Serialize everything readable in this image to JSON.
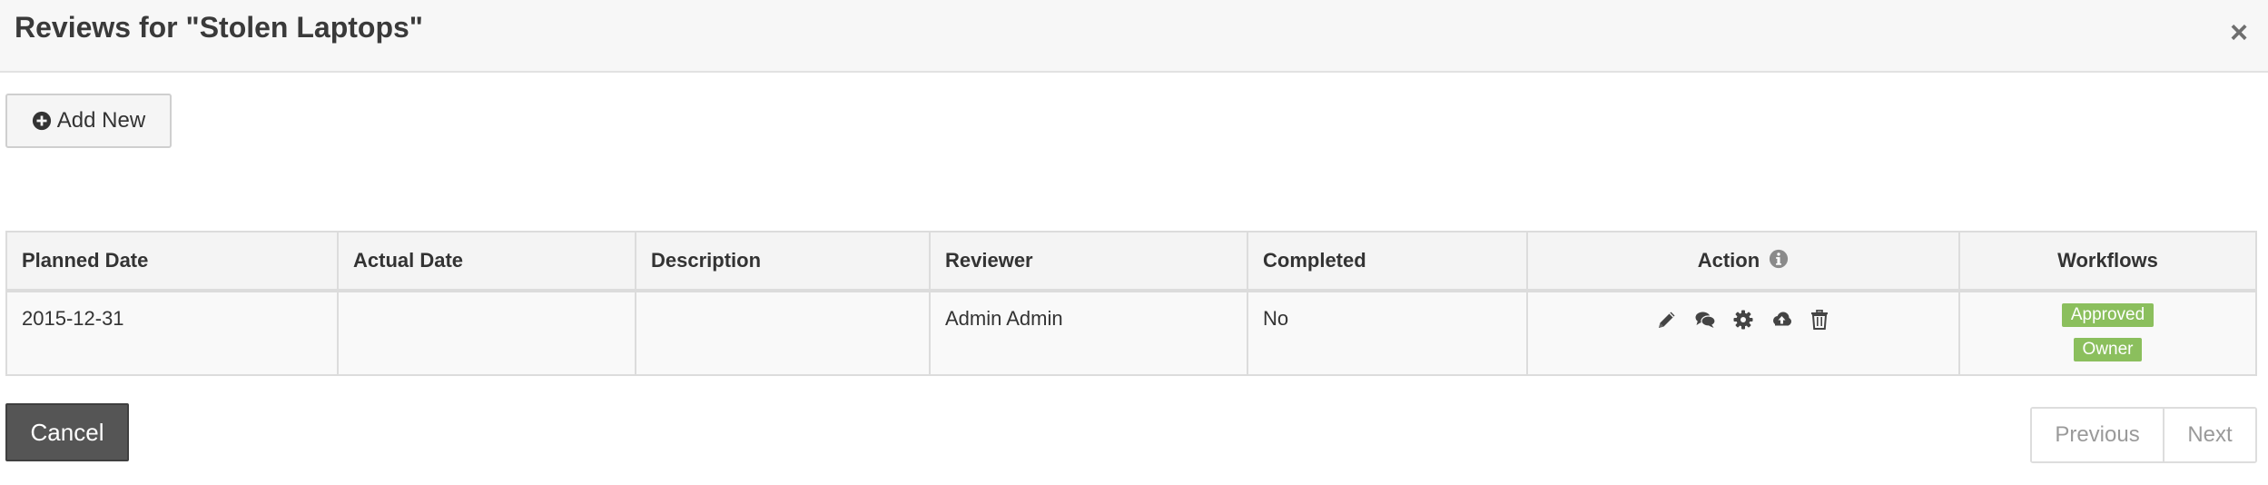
{
  "modal": {
    "title": "Reviews for \"Stolen Laptops\"",
    "close_label": "×"
  },
  "toolbar": {
    "add_new_label": "Add New",
    "add_new_icon": "plus-circle-icon"
  },
  "table": {
    "headers": {
      "planned_date": "Planned Date",
      "actual_date": "Actual Date",
      "description": "Description",
      "reviewer": "Reviewer",
      "completed": "Completed",
      "action": "Action",
      "workflows": "Workflows"
    },
    "rows": [
      {
        "planned_date": "2015-12-31",
        "actual_date": "",
        "description": "",
        "reviewer": "Admin Admin",
        "completed": "No",
        "actions": [
          "pencil-icon",
          "comments-icon",
          "gear-icon",
          "cloud-upload-icon",
          "trash-icon"
        ],
        "workflows": [
          "Approved",
          "Owner"
        ]
      }
    ]
  },
  "footer": {
    "cancel_label": "Cancel",
    "previous_label": "Previous",
    "next_label": "Next"
  },
  "colors": {
    "badge": "#8bbf5d",
    "cancel_button": "#555555",
    "header_bg": "#f7f7f7"
  }
}
